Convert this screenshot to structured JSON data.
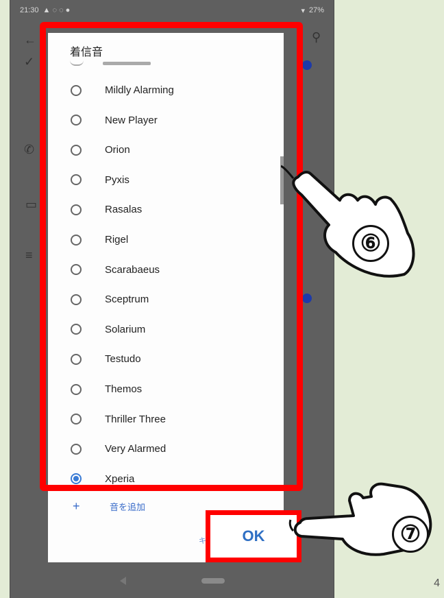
{
  "status_bar": {
    "time": "21:30",
    "battery": "27%"
  },
  "dialog": {
    "title": "着信音",
    "items": [
      {
        "label": "Mildly Alarming",
        "selected": false
      },
      {
        "label": "New Player",
        "selected": false
      },
      {
        "label": "Orion",
        "selected": false
      },
      {
        "label": "Pyxis",
        "selected": false
      },
      {
        "label": "Rasalas",
        "selected": false
      },
      {
        "label": "Rigel",
        "selected": false
      },
      {
        "label": "Scarabaeus",
        "selected": false
      },
      {
        "label": "Sceptrum",
        "selected": false
      },
      {
        "label": "Solarium",
        "selected": false
      },
      {
        "label": "Testudo",
        "selected": false
      },
      {
        "label": "Themos",
        "selected": false
      },
      {
        "label": "Thriller Three",
        "selected": false
      },
      {
        "label": "Very Alarmed",
        "selected": false
      },
      {
        "label": "Xperia",
        "selected": true
      }
    ],
    "add_sound": "音を追加",
    "cancel_label": "キャンセル",
    "ok_label": "OK"
  },
  "annotations": {
    "step6": "⑥",
    "step7": "⑦"
  },
  "page_number": "4",
  "colors": {
    "highlight": "#ff0000",
    "accent": "#3a7bd5",
    "background": "#e3ecd6"
  }
}
